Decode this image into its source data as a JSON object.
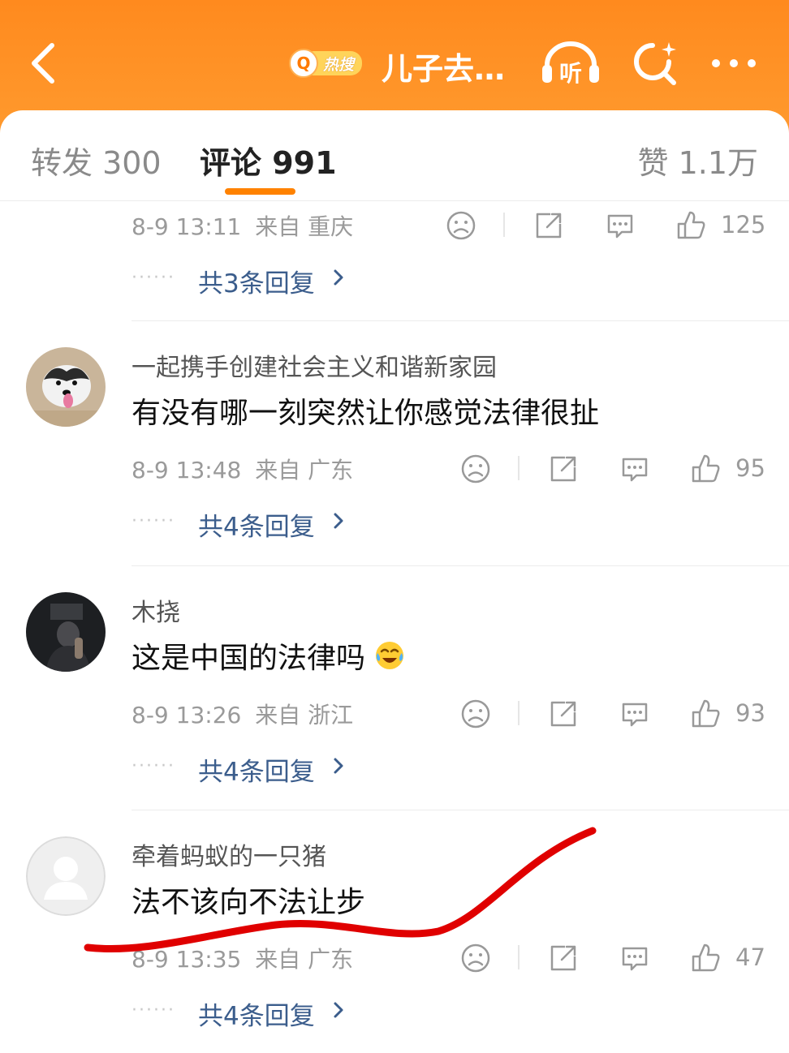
{
  "header": {
    "back_icon": "chevron-left-icon",
    "hot_badge_label": "热搜",
    "title": "儿子去…",
    "listen_label": "听",
    "icons": [
      "back-icon",
      "search-icon",
      "listen-icon",
      "more-icon"
    ],
    "accent_color": "#ff8a1e"
  },
  "tabs": {
    "repost": "转发 300",
    "comments": "评论 991",
    "likes": "赞 1.1万",
    "active": "comments"
  },
  "comments": [
    {
      "username": "",
      "text": "",
      "time": "8-9 13:11",
      "location": "来自 重庆",
      "likes": "125",
      "replies": "共3条回复"
    },
    {
      "username": "一起携手创建社会主义和谐新家园",
      "text": "有没有哪一刻突然让你感觉法律很扯",
      "time": "8-9 13:48",
      "location": "来自 广东",
      "likes": "95",
      "replies": "共4条回复"
    },
    {
      "username": "木挠",
      "text": "这是中国的法律吗",
      "emoji": "laugh-cry-emoji",
      "time": "8-9 13:26",
      "location": "来自 浙江",
      "likes": "93",
      "replies": "共4条回复"
    },
    {
      "username": "牵着蚂蚁的一只猪",
      "text": "法不该向不法让步",
      "time": "8-9 13:35",
      "location": "来自 广东",
      "likes": "47",
      "replies": "共4条回复"
    }
  ],
  "annotation": {
    "type": "red-freehand-underline",
    "color": "#e00000"
  }
}
